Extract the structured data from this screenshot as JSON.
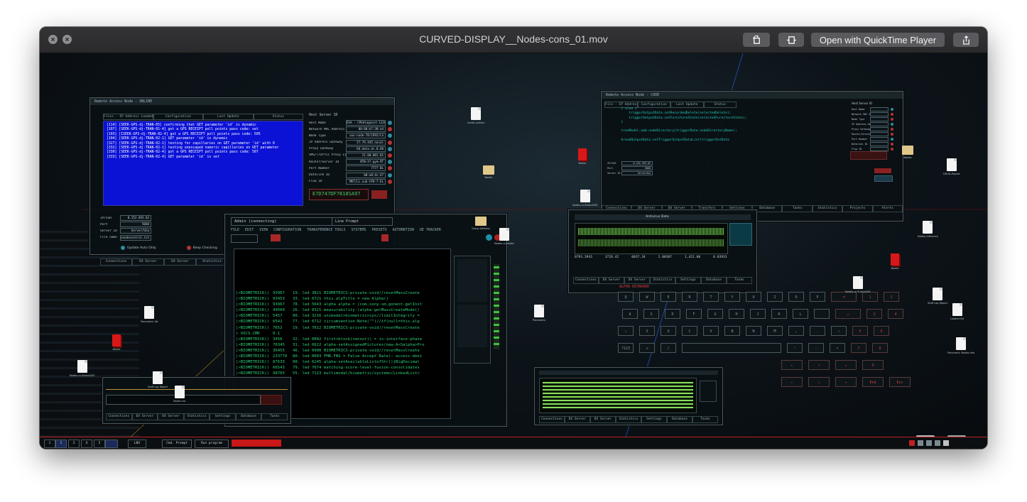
{
  "window": {
    "title": "CURVED-DISPLAY__Nodes-cons_01.mov",
    "open_with_label": "Open with QuickTime Player",
    "icons": [
      "close-icon",
      "minimize-icon",
      "rotate-icon",
      "trim-icon",
      "share-icon"
    ]
  },
  "remote_panel": {
    "title": "Remote Access Node - ONLINE",
    "tabs": [
      "Files - IP Address Loaded (auto)",
      "Configuration",
      "Last Update",
      "Status"
    ],
    "log": [
      "[114] [SEEK-GPS-dj-TRAN-05] confirming that GET parameter 'id' is dynamic",
      "[107] [SEEK-GPS-dj-TRAN-01-4] got a GPS RECEIPT poll points pass code: set",
      "[103] [ISEEK-GPS-dj-TRAN-02-4] got a GPS RECEIPT poll points pass code: 505",
      "[104] [SEEK-GPS-dj-TRAN-02-1] GET parameter 'id' is dynamic",
      "[327] [SEEK-GPS-dj-TRAN-02-1] testing for capillaries on GET parameter 'id' with 0",
      "[332] [SEEK-GPS-dj-TRAN-02-1] testing unescaped numeric capillaries on GET parameter",
      "[330] [SEEK-GPS-dj-TRAN-02-4] got a GPS RECEIPT poll points pass code: 507",
      "[333] [SEEK-GPS-dj-TRAN-02-4] GET parameter 'id' is set"
    ],
    "fields_header": "Host Server ID",
    "fields": [
      {
        "label": "Host Name",
        "value": "ESA - CPUdiagnost-1320"
      },
      {
        "label": "Network MAC Address",
        "value": "00:80:b7:38:a4"
      },
      {
        "label": "Node Type",
        "value": "aux-node-78/1992/LS"
      },
      {
        "label": "IP Address Gateway",
        "value": "57.79.445.nosal"
      },
      {
        "label": "Proxy Gateway",
        "value": "66.data.dc.0.88"
      },
      {
        "label": "SMS/Traffic Proxy Line",
        "value": "21.00.001.01"
      },
      {
        "label": "Router/Server ID",
        "value": "NTW-X7-gym-9T"
      },
      {
        "label": "Port Number",
        "value": "7777 BL"
      },
      {
        "label": "Datalink ID",
        "value": "00:e0:4c:47"
      },
      {
        "label": "Flow ID",
        "value": "MKT/LL.sub-CPU-7-EL"
      }
    ],
    "hex_code": "E7D747DF7818SA97",
    "mini_fields": [
      {
        "label": "IP/SSH",
        "value": "0.152.493.02"
      },
      {
        "label": "Port",
        "value": "5060"
      },
      {
        "label": "Server ID",
        "value": "Server/Una"
      },
      {
        "label": "File name",
        "value": "xnodecontrol.txt"
      }
    ],
    "options": [
      "Update Auto Only",
      "Keep Checking"
    ],
    "bottom_tabs": [
      "Connections",
      "DX Server",
      "DX Server",
      "Statistics",
      "Settings"
    ]
  },
  "console": {
    "title": "Admin (connecting)",
    "subtitle": "Line Prompt",
    "menu": [
      "FILE",
      "EDIT",
      "VIEW",
      "CONFIGURATION",
      "TRANSFERENCE TOOLS",
      "SYSTEMS",
      "PRESETS",
      "AUTOMATION",
      "UE TRACKER"
    ],
    "lines": [
      [
        "|>BIOMETRICK()",
        "93967",
        "19. led 3821",
        "BIOMETRICS-private-void//resetMassCreate"
      ],
      [
        "|>BIOMETRICK()",
        "93453",
        "33. led 6721",
        "this.alpTitle = new Alpha()"
      ],
      [
        "|>BIOMETRICK()",
        "93967",
        "78. led 5643",
        "alpha alpha = (com.sony-sm.gonent-getInst"
      ],
      [
        "|>BIOMETRICK()",
        "49560",
        "26. led 8321",
        "measurability-(alpha-getMassCreateMode()"
      ],
      [
        "|>BIOMETRICK()",
        "5457",
        "80. led 3216",
        "unimodal>biometric>sys//limitIntegrity ="
      ],
      [
        "|>BIOMETRICK()",
        "6541",
        "77. led 6712",
        "circumvention-Note(\"\")//if(null=this.alp"
      ],
      [
        "|>BIOMETRICK()",
        "7652",
        "19. led 7612",
        "BIOMETRICS-private-void//resetMassCreate"
      ],
      [
        ">  VOCS.CMD",
        "0.1",
        "",
        ""
      ],
      [
        "|>BIOMETRICK()",
        "3456",
        "32. led 0002",
        "first>block(sensor)) = is-interface-phase"
      ],
      [
        "|>BIOMETRICK()",
        "76345",
        "31. led 6622",
        "alpha-setAssignedPictures(new-A<Salpha>Pro"
      ],
      [
        "|>BIOMETRICK()",
        "36455",
        "46. led 0900",
        "BIOMETRICS-private-void//resetMassCreate"
      ],
      [
        "|>BIOMETRICK()",
        "233770",
        "80. led 0003",
        "FMR.FNS = False Accept Rate): access-deni"
      ],
      [
        "|>BIOMETRICK()",
        "87633",
        "00. led 6245",
        "alpha-setAvailableListofStr()}BigDecimal"
      ],
      [
        "|>BIOMETRICK()",
        "66543",
        "79. led 7674",
        "matching-score-level-fusion-consolidates"
      ],
      [
        "|>BIOMETRICK()",
        "98765",
        "55. led 7123",
        "multimodal/biometric/systems(LinkedList<"
      ]
    ]
  },
  "code_panel": {
    "title": "Remote Access Node - CODE",
    "tabs": [
      "File - IP Address",
      "Configuration",
      "Last Update",
      "Status"
    ],
    "code": "  } else {\n      triggerOutputData.setRecordedDelete(selectedDelete);\n      triggerOutputData.setFurnitureState(selectedFurnitureState);\n  }\n\n  treeModel.add.nodeDirectory(triggerData.nodeDirectoryName);\n\n  broadOutputData.setTriggerOutputDataList(triggerOutData",
    "side_header": "Host Server ID",
    "side_fields": [
      "Host Name",
      "Network MAC Address",
      "Node Type",
      "IP Address Gateway",
      "Proxy Gateway",
      "Router/Server ID",
      "Port Number",
      "Datalink ID",
      "Flow ID"
    ],
    "bottom_tabs": [
      "Connections",
      "DX Server",
      "DX Server",
      "Transfers",
      "Settings",
      "Database",
      "Tasks",
      "Statistics",
      "Projects",
      "Alerts"
    ],
    "mini_fields": [
      {
        "label": "IP/SSH",
        "value": "0.152.493.02"
      },
      {
        "label": "Port",
        "value": "5060"
      },
      {
        "label": "Server ID",
        "value": "ServerUna"
      }
    ]
  },
  "meter_panel": {
    "title": "Antivirus Data",
    "readouts": [
      "0793.3943",
      "3726.42",
      "0037.34",
      "2.00387",
      "1,421.00",
      "0.03933"
    ],
    "tabs": [
      "Connections",
      "DX Server",
      "DX Server",
      "Statistics",
      "Settings",
      "Database",
      "Tasks"
    ]
  },
  "keyboard": {
    "title": "ALPHA KEYBOARD",
    "rows": [
      [
        "Q",
        "W",
        "E",
        "R",
        "T",
        "Y",
        "U",
        "I",
        "O",
        "P",
        "⌫",
        "1",
        "2"
      ],
      [
        "A",
        "S",
        "D",
        "F",
        "G",
        "H",
        "J",
        "K",
        "L",
        "",
        "↵",
        "3",
        "4"
      ],
      [
        "⇧",
        "Z",
        "X",
        "C",
        "V",
        "B",
        "N",
        "M",
        ",",
        ".",
        "⇧",
        "5",
        "6"
      ],
      [
        "?123",
        "⌂",
        "/",
        "",
        "",
        "",
        "",
        "",
        "'",
        "-",
        "⌕",
        "7",
        "8"
      ],
      [
        "↖",
        "↑",
        "↗",
        "9"
      ],
      [
        "←",
        "↓",
        "→",
        "End",
        "Esc"
      ]
    ]
  },
  "bottom_left_panel": {
    "tabs": [
      "Connections",
      "DX Server",
      "DX Server",
      "Statistics",
      "Settings",
      "Database",
      "Tasks"
    ]
  },
  "bottom_meter_panel": {
    "tabs": [
      "Connections",
      "DX Server",
      "DX Server",
      "Statistics",
      "Settings",
      "Database",
      "Tasks"
    ]
  },
  "desktop_icons": [
    {
      "kind": "doc",
      "label": "nodes-system"
    },
    {
      "kind": "folder",
      "label": "Nodes"
    },
    {
      "kind": "redbook",
      "label": "Nodes"
    },
    {
      "kind": "doc",
      "label": "Nodes-ro-StatusDXS"
    },
    {
      "kind": "folder",
      "label": "Group Address"
    },
    {
      "kind": "doc",
      "label": "Nodes-ro-Nodes"
    },
    {
      "kind": "folder",
      "label": "Nodes"
    },
    {
      "kind": "doc",
      "label": "DB-NL-Report"
    },
    {
      "kind": "doc",
      "label": "Nodes-reference"
    },
    {
      "kind": "redbook",
      "label": "Nodes"
    },
    {
      "kind": "doc",
      "label": "Nodes-ro-StatusDXS"
    },
    {
      "kind": "doc",
      "label": "Staff Log Report"
    },
    {
      "kind": "doc",
      "label": "Loaded-list"
    },
    {
      "kind": "doc",
      "label": "Panoramic Nodes-Info"
    },
    {
      "kind": "doc",
      "label": "Panoramic"
    },
    {
      "kind": "doc",
      "label": "Panoramic-list"
    },
    {
      "kind": "redbook",
      "label": "Nodes"
    },
    {
      "kind": "doc",
      "label": "Nodes-ro-StatusDXS"
    },
    {
      "kind": "doc",
      "label": "Staff Log Report"
    },
    {
      "kind": "doc",
      "label": "Nodes-list"
    }
  ],
  "taskbar": {
    "items": [
      "1",
      "2",
      "3",
      "4",
      "5",
      "",
      "LNX",
      "Cmd. Prompt",
      "Run program"
    ]
  }
}
